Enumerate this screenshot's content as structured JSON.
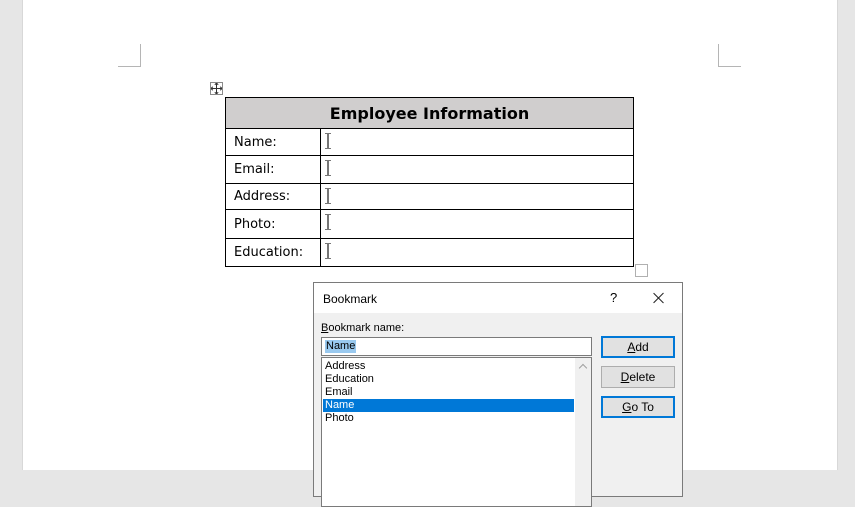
{
  "document": {
    "table_title": "Employee Information",
    "rows": [
      {
        "label": "Name:"
      },
      {
        "label": "Email:"
      },
      {
        "label": "Address:"
      },
      {
        "label": "Photo:"
      },
      {
        "label": "Education:"
      }
    ]
  },
  "dialog": {
    "title": "Bookmark",
    "help": "?",
    "bookmark_name_label": "Bookmark name:",
    "bookmark_name_value": "Name",
    "bookmarks": [
      "Address",
      "Education",
      "Email",
      "Name",
      "Photo"
    ],
    "selected": "Name",
    "buttons": {
      "add": {
        "first": "A",
        "rest": "dd"
      },
      "delete": {
        "first": "D",
        "rest": "elete"
      },
      "goto": {
        "first": "G",
        "rest": "o To"
      }
    }
  },
  "colors": {
    "header_fill": "#d0cece",
    "selection": "#0078d7",
    "input_highlight": "#99c9ef"
  }
}
